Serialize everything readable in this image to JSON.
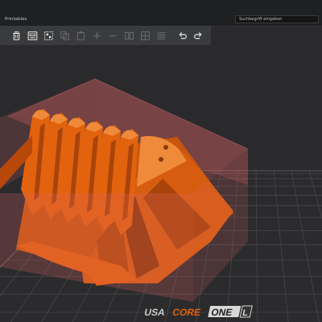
{
  "window": {
    "title": "Printables"
  },
  "search": {
    "placeholder": "Suchbegriff eingeben"
  },
  "toolbar": {
    "buttons": [
      {
        "icon": "delete-icon",
        "enabled": true
      },
      {
        "icon": "delete-all-icon",
        "enabled": true
      },
      {
        "icon": "arrange-icon",
        "enabled": true
      },
      {
        "icon": "copy-icon",
        "enabled": false
      },
      {
        "icon": "paste-icon",
        "enabled": false
      },
      {
        "icon": "add-instance-icon",
        "enabled": false
      },
      {
        "icon": "remove-instance-icon",
        "enabled": false
      },
      {
        "icon": "split-to-objects-icon",
        "enabled": false
      },
      {
        "icon": "split-to-parts-icon",
        "enabled": false
      },
      {
        "icon": "variable-layer-height-icon",
        "enabled": false
      },
      {
        "icon": "undo-icon",
        "enabled": true
      },
      {
        "icon": "redo-icon",
        "enabled": true
      }
    ]
  },
  "bed": {
    "brand_prefix": "USA",
    "brand_core": "CORE",
    "brand_model": "ONE",
    "brand_suffix": "L"
  },
  "colors": {
    "model": "#e2620e",
    "model_shadow": "#a8440a",
    "model_highlight": "#ef8a3a",
    "bounding_box": "#e06565",
    "bed": "#2b2b2d",
    "grid": "#4a4a4d",
    "background": "#2a2a2d"
  }
}
